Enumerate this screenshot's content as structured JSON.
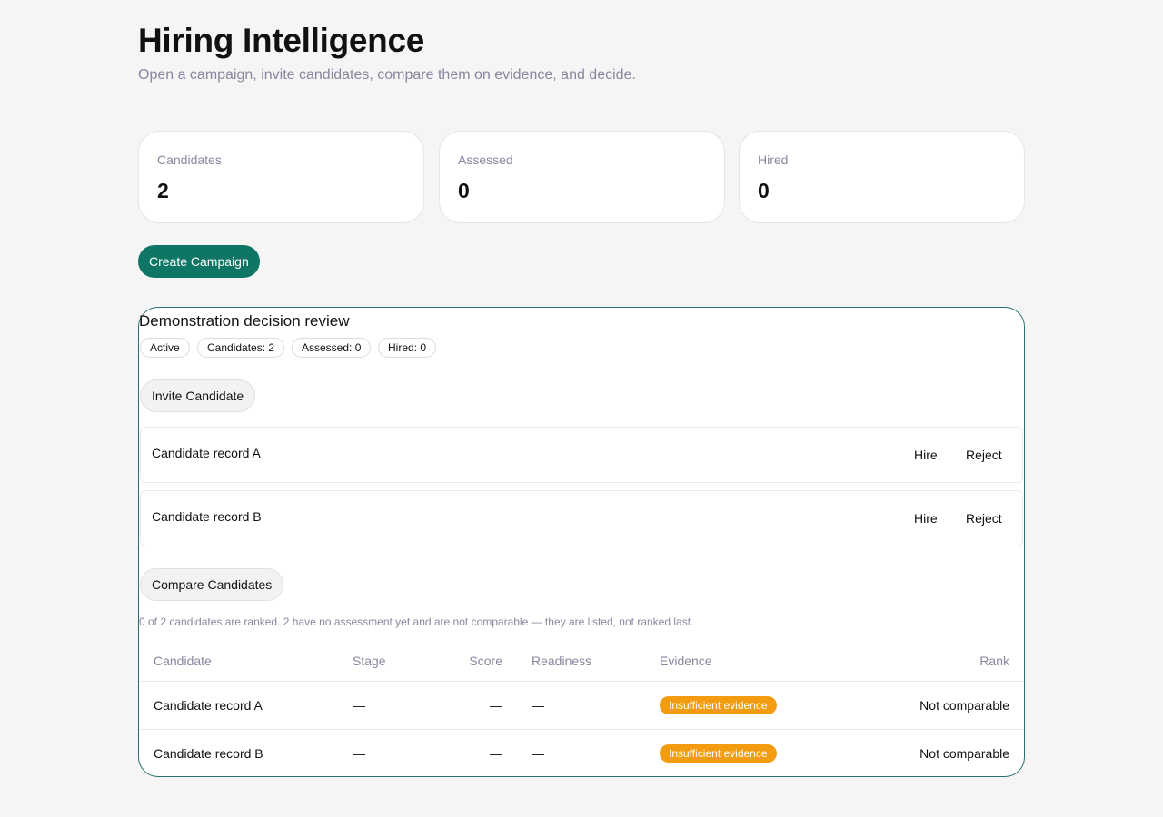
{
  "header": {
    "title": "Hiring Intelligence",
    "subtitle": "Open a campaign, invite candidates, compare them on evidence, and decide."
  },
  "stats": [
    {
      "label": "Candidates",
      "value": "2"
    },
    {
      "label": "Assessed",
      "value": "0"
    },
    {
      "label": "Hired",
      "value": "0"
    }
  ],
  "actions": {
    "create_campaign": "Create Campaign"
  },
  "campaign": {
    "title": "Demonstration decision review",
    "pills": [
      "Active",
      "Candidates: 2",
      "Assessed: 0",
      "Hired: 0"
    ],
    "invite_label": "Invite Candidate",
    "candidates": [
      {
        "name": "Candidate record A",
        "hire": "Hire",
        "reject": "Reject"
      },
      {
        "name": "Candidate record B",
        "hire": "Hire",
        "reject": "Reject"
      }
    ],
    "compare_label": "Compare Candidates",
    "rank_note": "0 of 2 candidates are ranked. 2 have no assessment yet and are not comparable — they are listed, not ranked last.",
    "table": {
      "headers": [
        "Candidate",
        "Stage",
        "Score",
        "Readiness",
        "Evidence",
        "Rank"
      ],
      "rows": [
        {
          "candidate": "Candidate record A",
          "stage": "—",
          "score": "—",
          "readiness": "—",
          "evidence": "Insufficient evidence",
          "rank": "Not comparable"
        },
        {
          "candidate": "Candidate record B",
          "stage": "—",
          "score": "—",
          "readiness": "—",
          "evidence": "Insufficient evidence",
          "rank": "Not comparable"
        }
      ]
    }
  },
  "colors": {
    "primary": "#0f7564",
    "warning": "#f39c12",
    "muted_text": "#8b86a0",
    "campaign_border": "#2a6f6f"
  }
}
